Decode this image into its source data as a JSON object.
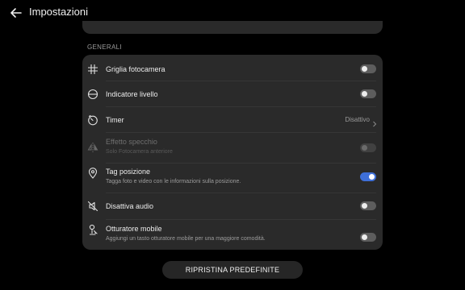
{
  "header": {
    "title": "Impostazioni",
    "back_icon": "arrow-left-icon"
  },
  "section": {
    "title": "GENERALI"
  },
  "rows": [
    {
      "label": "Griglia fotocamera",
      "icon": "grid-icon",
      "toggle": false
    },
    {
      "label": "Indicatore livello",
      "icon": "level-icon",
      "toggle": false
    },
    {
      "label": "Timer",
      "icon": "timer-icon",
      "value": "Disattivo"
    },
    {
      "label": "Effetto specchio",
      "sublabel": "Solo Fotocamera anteriore",
      "icon": "mirror-icon",
      "toggle": false,
      "disabled": true
    },
    {
      "label": "Tag posizione",
      "sublabel": "Tagga foto e video con le informazioni sulla posizione.",
      "icon": "location-pin-icon",
      "toggle": true
    },
    {
      "label": "Disattiva audio",
      "icon": "mute-icon",
      "toggle": false
    },
    {
      "label": "Otturatore mobile",
      "sublabel": "Aggiungi un tasto otturatore mobile per una maggiore comodità.",
      "icon": "floating-shutter-icon",
      "toggle": false
    }
  ],
  "reset_button": {
    "label": "RIPRISTINA PREDEFINITE"
  },
  "colors": {
    "accent": "#3e6fd8",
    "card": "#2a2a2a",
    "background": "#000000"
  }
}
